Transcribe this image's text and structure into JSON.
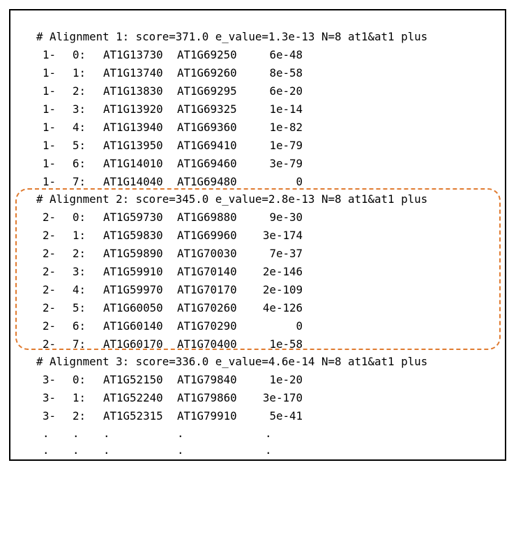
{
  "headers": [
    "# Alignment 1: score=371.0 e_value=1.3e-13 N=8 at1&at1 plus",
    "# Alignment 2: score=345.0 e_value=2.8e-13 N=8 at1&at1 plus",
    "# Alignment 3: score=336.0 e_value=4.6e-14 N=8 at1&at1 plus"
  ],
  "rows": [
    {
      "aln": "1-",
      "idx": "0:",
      "g1": "AT1G13730",
      "g2": "AT1G69250",
      "ev": "6e-48"
    },
    {
      "aln": "1-",
      "idx": "1:",
      "g1": "AT1G13740",
      "g2": "AT1G69260",
      "ev": "8e-58"
    },
    {
      "aln": "1-",
      "idx": "2:",
      "g1": "AT1G13830",
      "g2": "AT1G69295",
      "ev": "6e-20"
    },
    {
      "aln": "1-",
      "idx": "3:",
      "g1": "AT1G13920",
      "g2": "AT1G69325",
      "ev": "1e-14"
    },
    {
      "aln": "1-",
      "idx": "4:",
      "g1": "AT1G13940",
      "g2": "AT1G69360",
      "ev": "1e-82"
    },
    {
      "aln": "1-",
      "idx": "5:",
      "g1": "AT1G13950",
      "g2": "AT1G69410",
      "ev": "1e-79"
    },
    {
      "aln": "1-",
      "idx": "6:",
      "g1": "AT1G14010",
      "g2": "AT1G69460",
      "ev": "3e-79"
    },
    {
      "aln": "1-",
      "idx": "7:",
      "g1": "AT1G14040",
      "g2": "AT1G69480",
      "ev": "0"
    },
    {
      "aln": "2-",
      "idx": "0:",
      "g1": "AT1G59730",
      "g2": "AT1G69880",
      "ev": "9e-30"
    },
    {
      "aln": "2-",
      "idx": "1:",
      "g1": "AT1G59830",
      "g2": "AT1G69960",
      "ev": "3e-174"
    },
    {
      "aln": "2-",
      "idx": "2:",
      "g1": "AT1G59890",
      "g2": "AT1G70030",
      "ev": "7e-37"
    },
    {
      "aln": "2-",
      "idx": "3:",
      "g1": "AT1G59910",
      "g2": "AT1G70140",
      "ev": "2e-146"
    },
    {
      "aln": "2-",
      "idx": "4:",
      "g1": "AT1G59970",
      "g2": "AT1G70170",
      "ev": "2e-109"
    },
    {
      "aln": "2-",
      "idx": "5:",
      "g1": "AT1G60050",
      "g2": "AT1G70260",
      "ev": "4e-126"
    },
    {
      "aln": "2-",
      "idx": "6:",
      "g1": "AT1G60140",
      "g2": "AT1G70290",
      "ev": "0"
    },
    {
      "aln": "2-",
      "idx": "7:",
      "g1": "AT1G60170",
      "g2": "AT1G70400",
      "ev": "1e-58"
    },
    {
      "aln": "3-",
      "idx": "0:",
      "g1": "AT1G52150",
      "g2": "AT1G79840",
      "ev": "1e-20"
    },
    {
      "aln": "3-",
      "idx": "1:",
      "g1": "AT1G52240",
      "g2": "AT1G79860",
      "ev": "3e-170"
    },
    {
      "aln": "3-",
      "idx": "2:",
      "g1": "AT1G52315",
      "g2": "AT1G79910",
      "ev": "5e-41"
    }
  ],
  "continuation_dot": ".",
  "highlight_color": "#e07b30"
}
